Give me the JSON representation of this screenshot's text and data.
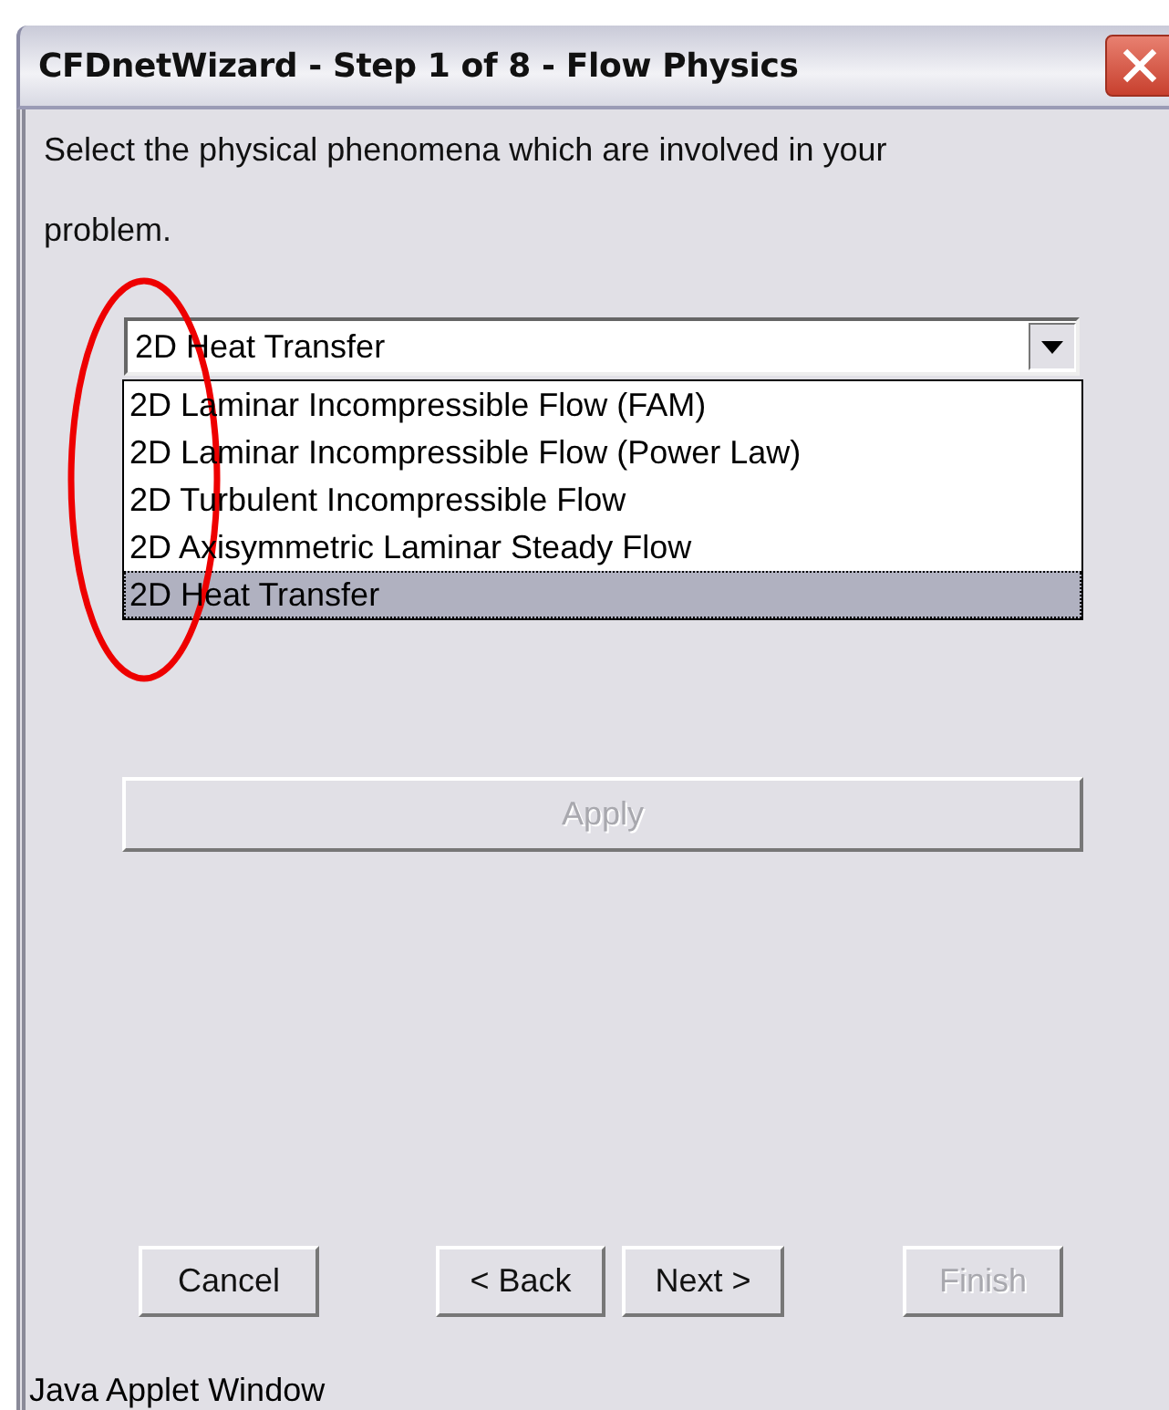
{
  "window": {
    "title": "CFDnetWizard - Step 1 of 8 - Flow Physics"
  },
  "instruction": "Select the physical phenomena which are involved in your problem.",
  "dropdown": {
    "value": "2D Heat Transfer",
    "expanded": true,
    "options": [
      {
        "label": "2D Laminar Incompressible Flow (FAM)",
        "selected": false
      },
      {
        "label": "2D Laminar Incompressible Flow (Power Law)",
        "selected": false
      },
      {
        "label": "2D Turbulent Incompressible Flow",
        "selected": false
      },
      {
        "label": "2D Axisymmetric Laminar Steady Flow",
        "selected": false
      },
      {
        "label": "2D Heat Transfer",
        "selected": true
      }
    ]
  },
  "apply_button": {
    "label": "Apply",
    "disabled": true
  },
  "buttons": [
    {
      "label": "Cancel",
      "disabled": false
    },
    {
      "label": "< Back",
      "disabled": false
    },
    {
      "label": "Next >",
      "disabled": false
    },
    {
      "label": "Finish",
      "disabled": true
    }
  ],
  "status_bar": "Java Applet Window",
  "annotations": [
    {
      "kind": "ellipse"
    }
  ]
}
